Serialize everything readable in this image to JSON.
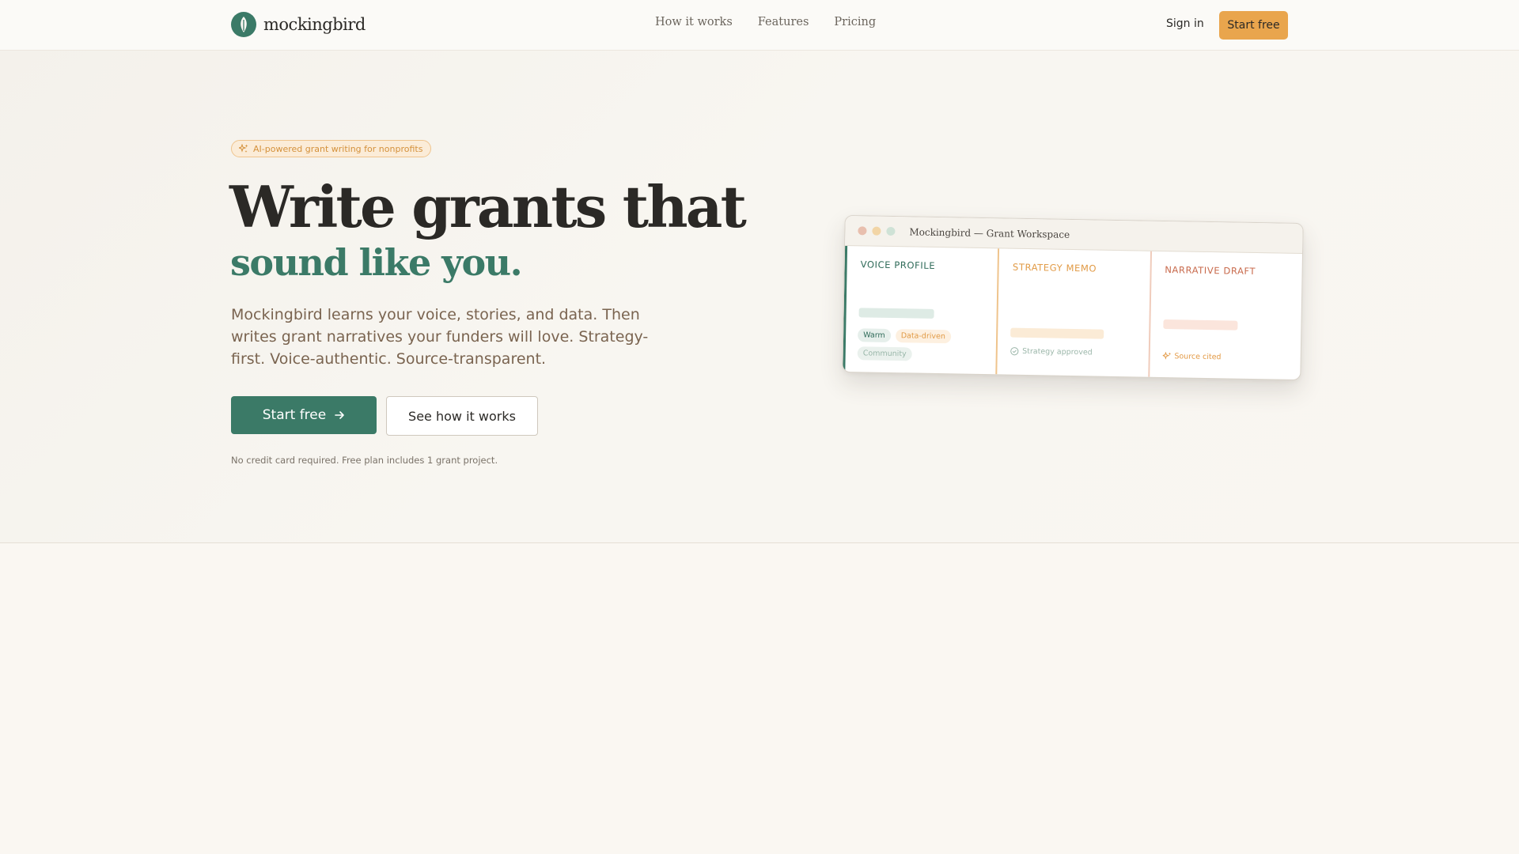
{
  "brand": {
    "name": "mockingbird",
    "logo_color": "#3b7a67",
    "accent_color": "#e9a54d"
  },
  "nav": {
    "links": [
      "How it works",
      "Features",
      "Pricing"
    ],
    "sign_in": "Sign in",
    "cta": "Start free"
  },
  "hero": {
    "badge": "AI-powered grant writing for nonprofits",
    "badge_icon": "sparkles-icon",
    "headline": "Write grants that",
    "subheadline": "sound like you.",
    "description": "Mockingbird learns your voice, stories, and data. Then writes grant narratives your funders will love. Strategy-first. Voice-authentic. Source-transparent.",
    "primary_cta": "Start free",
    "primary_cta_icon": "arrow-right-icon",
    "secondary_cta": "See how it works",
    "fineprint": "No credit card required. Free plan includes 1 grant project."
  },
  "workspace": {
    "title": "Mockingbird — Grant Workspace",
    "columns": [
      {
        "title": "VOICE PROFILE",
        "tags": [
          "Warm",
          "Data-driven",
          "Community"
        ]
      },
      {
        "title": "STRATEGY MEMO",
        "status": "Strategy approved",
        "status_icon": "check-circle-icon"
      },
      {
        "title": "NARRATIVE DRAFT",
        "status": "Source cited",
        "status_icon": "sparkles-icon"
      }
    ]
  }
}
